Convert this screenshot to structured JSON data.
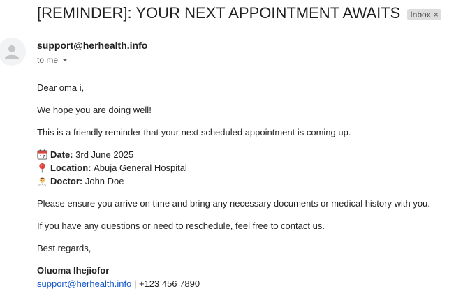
{
  "email": {
    "subject": "[REMINDER]: YOUR NEXT APPOINTMENT AWAITS",
    "label": "Inbox",
    "label_close": "×",
    "sender": "support@herhealth.info",
    "recipient": "to me"
  },
  "body": {
    "greeting": "Dear oma i,",
    "p1": "We hope you are doing well!",
    "p2": "This is a friendly reminder that your next scheduled appointment is coming up.",
    "details": {
      "date_label": "Date:",
      "date_value": "3rd June 2025",
      "location_label": "Location:",
      "location_value": "Abuja General Hospital",
      "doctor_label": "Doctor:",
      "doctor_value": "John Doe"
    },
    "p3": "Please ensure you arrive on time and bring any necessary documents or medical history with you.",
    "p4": "If you have any questions or need to reschedule, feel free to contact us.",
    "closing": "Best regards,",
    "signature_name": "Oluoma Ihejiofor",
    "signature_email": "support@herhealth.info",
    "signature_phone": "| +123 456 7890"
  },
  "icons": {
    "calendar": "calendar-icon",
    "pin": "pin-icon",
    "doctor": "doctor-icon",
    "avatar": "avatar-icon"
  },
  "colors": {
    "link": "#1155cc",
    "chip_bg": "#dddddd",
    "text": "#222222",
    "muted": "#5f6368"
  }
}
